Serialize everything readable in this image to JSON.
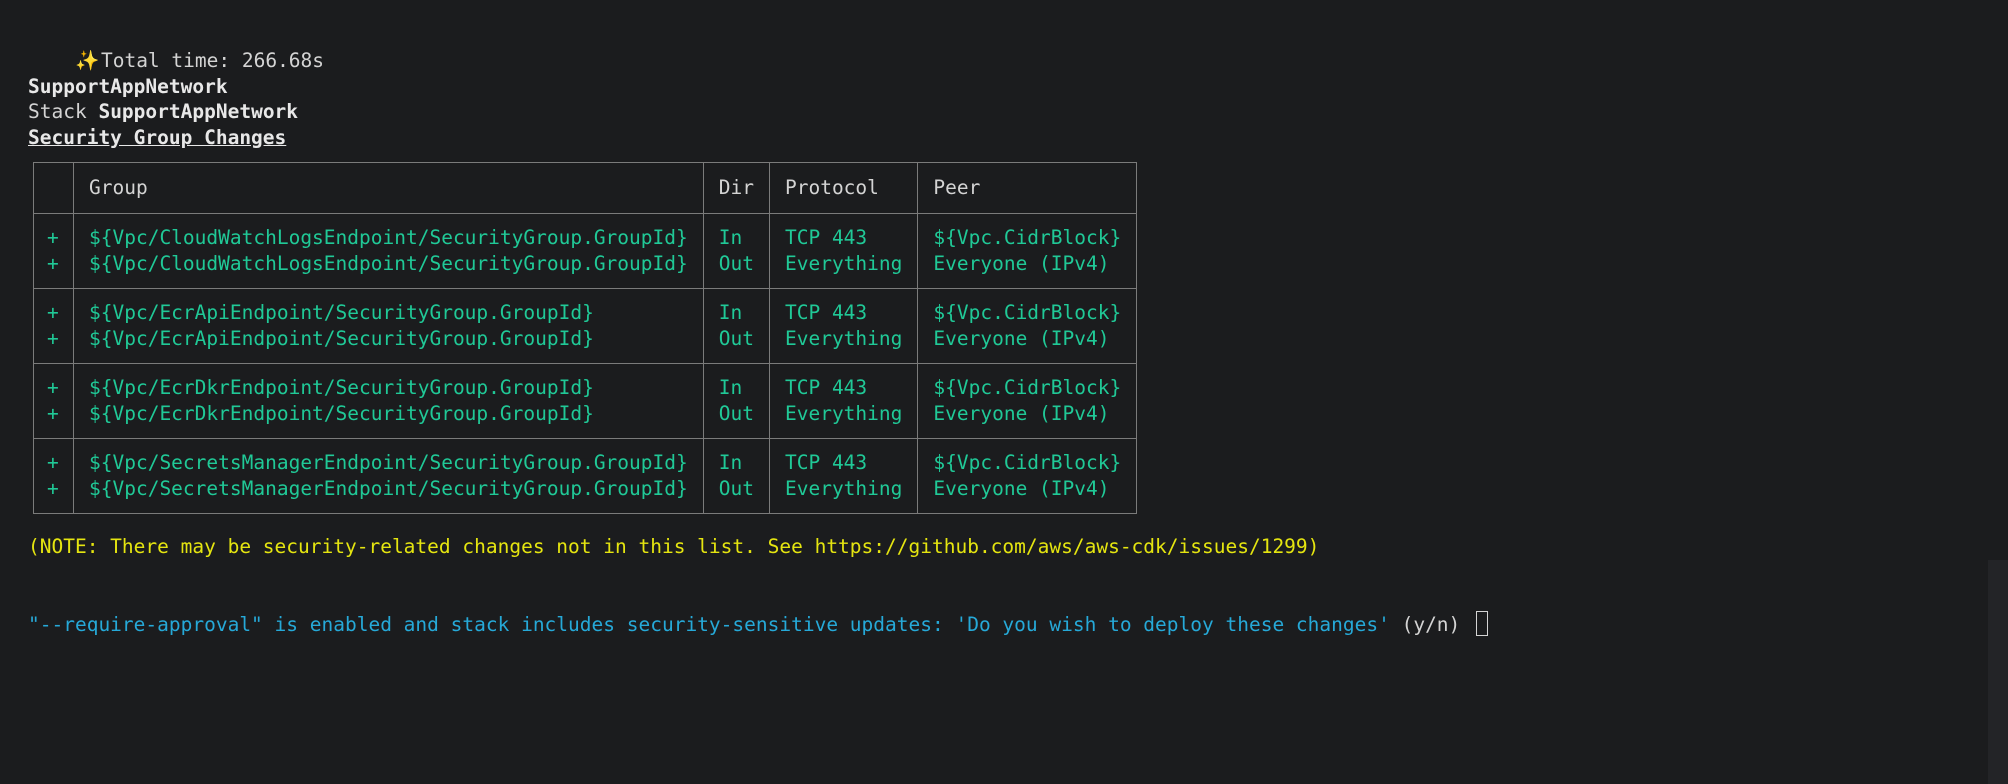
{
  "total_time_line": {
    "icon": "sparkles-icon",
    "text": "Total time: 266.68s"
  },
  "stack": {
    "name": "SupportAppNetwork",
    "label_prefix": "Stack ",
    "label_name": "SupportAppNetwork",
    "section_title": "Security Group Changes"
  },
  "table": {
    "headers": [
      "",
      "Group",
      "Dir",
      "Protocol",
      "Peer"
    ],
    "rows": [
      {
        "signs": [
          "+",
          "+"
        ],
        "groups": [
          "${Vpc/CloudWatchLogsEndpoint/SecurityGroup.GroupId}",
          "${Vpc/CloudWatchLogsEndpoint/SecurityGroup.GroupId}"
        ],
        "dirs": [
          "In",
          "Out"
        ],
        "protocols": [
          "TCP 443",
          "Everything"
        ],
        "peers": [
          "${Vpc.CidrBlock}",
          "Everyone (IPv4)"
        ]
      },
      {
        "signs": [
          "+",
          "+"
        ],
        "groups": [
          "${Vpc/EcrApiEndpoint/SecurityGroup.GroupId}",
          "${Vpc/EcrApiEndpoint/SecurityGroup.GroupId}"
        ],
        "dirs": [
          "In",
          "Out"
        ],
        "protocols": [
          "TCP 443",
          "Everything"
        ],
        "peers": [
          "${Vpc.CidrBlock}",
          "Everyone (IPv4)"
        ]
      },
      {
        "signs": [
          "+",
          "+"
        ],
        "groups": [
          "${Vpc/EcrDkrEndpoint/SecurityGroup.GroupId}",
          "${Vpc/EcrDkrEndpoint/SecurityGroup.GroupId}"
        ],
        "dirs": [
          "In",
          "Out"
        ],
        "protocols": [
          "TCP 443",
          "Everything"
        ],
        "peers": [
          "${Vpc.CidrBlock}",
          "Everyone (IPv4)"
        ]
      },
      {
        "signs": [
          "+",
          "+"
        ],
        "groups": [
          "${Vpc/SecretsManagerEndpoint/SecurityGroup.GroupId}",
          "${Vpc/SecretsManagerEndpoint/SecurityGroup.GroupId}"
        ],
        "dirs": [
          "In",
          "Out"
        ],
        "protocols": [
          "TCP 443",
          "Everything"
        ],
        "peers": [
          "${Vpc.CidrBlock}",
          "Everyone (IPv4)"
        ]
      }
    ]
  },
  "note": "(NOTE: There may be security-related changes not in this list. See https://github.com/aws/aws-cdk/issues/1299)",
  "prompt": {
    "message": "\"--require-approval\" is enabled and stack includes security-sensitive updates: 'Do you wish to deploy these changes'",
    "choice": " (y/n) "
  },
  "colors": {
    "background": "#1b1c1e",
    "added": "#20c997",
    "note": "#e5e510",
    "prompt": "#26a9d8",
    "text": "#d4d4d4"
  }
}
